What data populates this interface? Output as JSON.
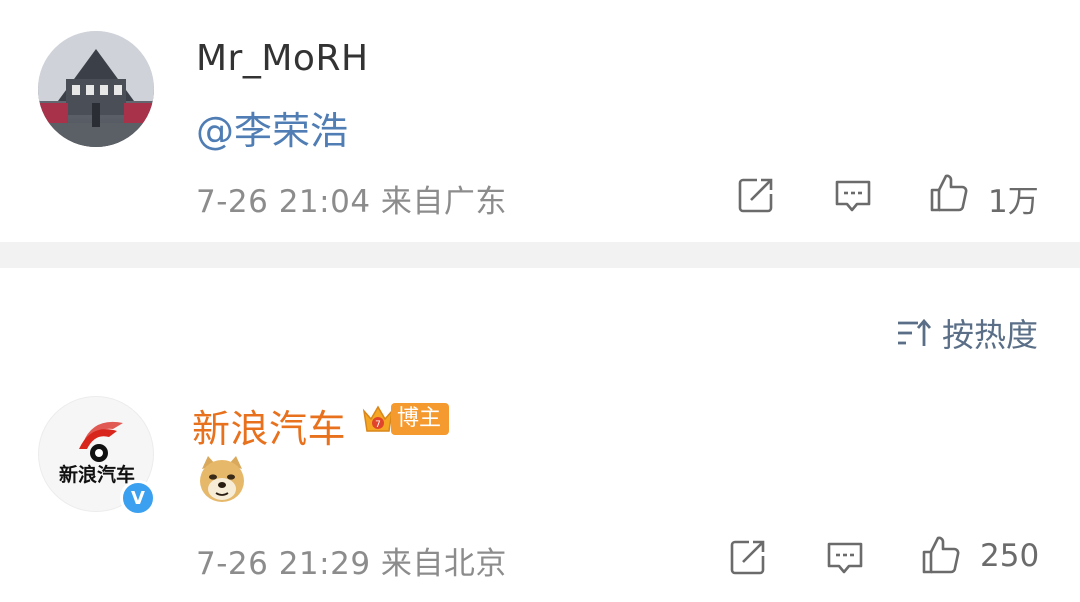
{
  "post": {
    "username": "Mr_MoRH",
    "mention": "@李荣浩",
    "meta": "7-26 21:04 来自广东",
    "like_count": "1万"
  },
  "sort": {
    "label": "按热度"
  },
  "comment": {
    "username": "新浪汽车",
    "avatar_text": "新浪汽车",
    "badge_label": "博主",
    "verified_mark": "V",
    "emoji": "doge",
    "meta": "7-26 21:29 来自北京",
    "like_count": "250"
  },
  "colors": {
    "mention": "#4f7db4",
    "comment_username": "#e8711e",
    "badge": "#f59a2f",
    "verified": "#3aa0ef",
    "meta_gray": "#8c8c8c"
  }
}
